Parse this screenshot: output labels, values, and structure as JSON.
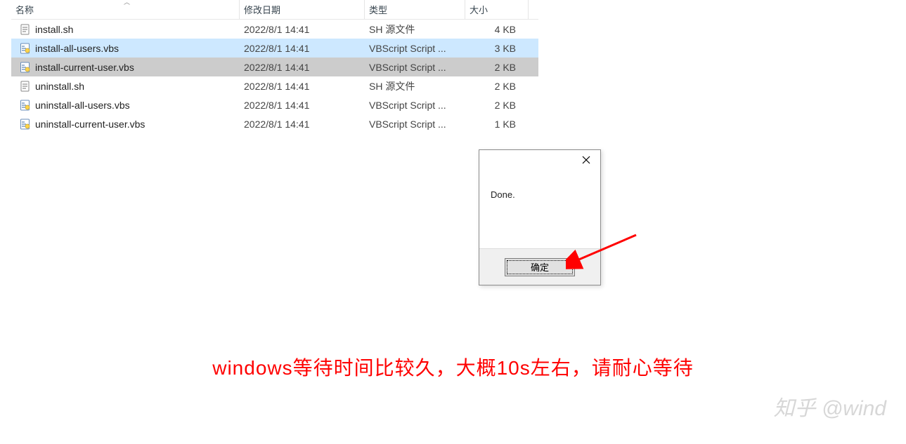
{
  "columns": {
    "name": "名称",
    "date": "修改日期",
    "type": "类型",
    "size": "大小"
  },
  "files": [
    {
      "name": "install.sh",
      "date": "2022/8/1 14:41",
      "type": "SH 源文件",
      "size": "4 KB",
      "icon": "sh",
      "state": ""
    },
    {
      "name": "install-all-users.vbs",
      "date": "2022/8/1 14:41",
      "type": "VBScript Script ...",
      "size": "3 KB",
      "icon": "vbs",
      "state": "selected-light"
    },
    {
      "name": "install-current-user.vbs",
      "date": "2022/8/1 14:41",
      "type": "VBScript Script ...",
      "size": "2 KB",
      "icon": "vbs",
      "state": "selected-focus"
    },
    {
      "name": "uninstall.sh",
      "date": "2022/8/1 14:41",
      "type": "SH 源文件",
      "size": "2 KB",
      "icon": "sh",
      "state": ""
    },
    {
      "name": "uninstall-all-users.vbs",
      "date": "2022/8/1 14:41",
      "type": "VBScript Script ...",
      "size": "2 KB",
      "icon": "vbs",
      "state": ""
    },
    {
      "name": "uninstall-current-user.vbs",
      "date": "2022/8/1 14:41",
      "type": "VBScript Script ...",
      "size": "1 KB",
      "icon": "vbs",
      "state": ""
    }
  ],
  "dialog": {
    "message": "Done.",
    "ok_label": "确定"
  },
  "caption": "windows等待时间比较久，大概10s左右，请耐心等待",
  "watermark": "知乎 @wind"
}
